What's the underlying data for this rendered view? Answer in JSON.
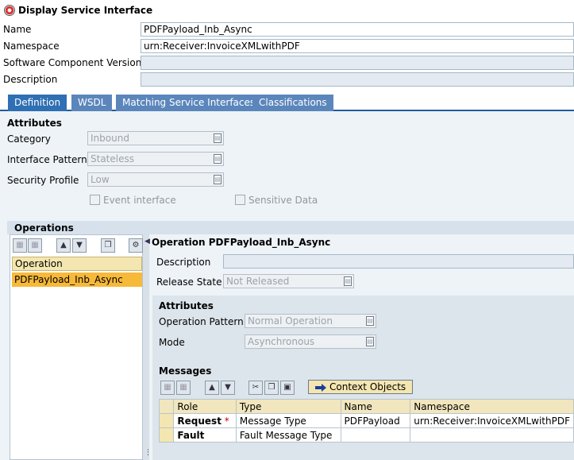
{
  "window": {
    "title": "Display Service Interface"
  },
  "header_fields": {
    "name_label": "Name",
    "name_value": "PDFPayload_Inb_Async",
    "namespace_label": "Namespace",
    "namespace_value": "urn:Receiver:InvoiceXMLwithPDF",
    "scv_label": "Software Component Version",
    "scv_value": "",
    "description_label": "Description",
    "description_value": ""
  },
  "tabs": [
    "Definition",
    "WSDL",
    "Matching Service Interfaces",
    "Classifications"
  ],
  "attributes": {
    "heading": "Attributes",
    "category_label": "Category",
    "category_value": "Inbound",
    "pattern_label": "Interface Pattern",
    "pattern_value": "Stateless",
    "security_label": "Security Profile",
    "security_value": "Low",
    "event_interface": "Event interface",
    "sensitive_data": "Sensitive Data"
  },
  "operations": {
    "heading": "Operations",
    "column": "Operation",
    "rows": [
      "PDFPayload_Inb_Async"
    ]
  },
  "operation_detail": {
    "title": "Operation PDFPayload_Inb_Async",
    "description_label": "Description",
    "description_value": "",
    "release_label": "Release State",
    "release_value": "Not Released",
    "attributes_heading": "Attributes",
    "op_pattern_label": "Operation Pattern",
    "op_pattern_value": "Normal Operation",
    "mode_label": "Mode",
    "mode_value": "Asynchronous",
    "messages_heading": "Messages",
    "context_objects": "Context Objects"
  },
  "messages_table": {
    "columns": [
      "Role",
      "Type",
      "Name",
      "Namespace"
    ],
    "rows": [
      {
        "role": "Request",
        "required": "*",
        "type": "Message Type",
        "name": "PDFPayload",
        "namespace": "urn:Receiver:InvoiceXMLwithPDF"
      },
      {
        "role": "Fault",
        "required": "",
        "type": "Fault Message Type",
        "name": "",
        "namespace": ""
      }
    ]
  },
  "colors": {
    "tab_active": "#2f6fb3",
    "tab_bar": "#235a9e",
    "selected_row": "#f7b93a",
    "header_row": "#f4e6b0"
  }
}
